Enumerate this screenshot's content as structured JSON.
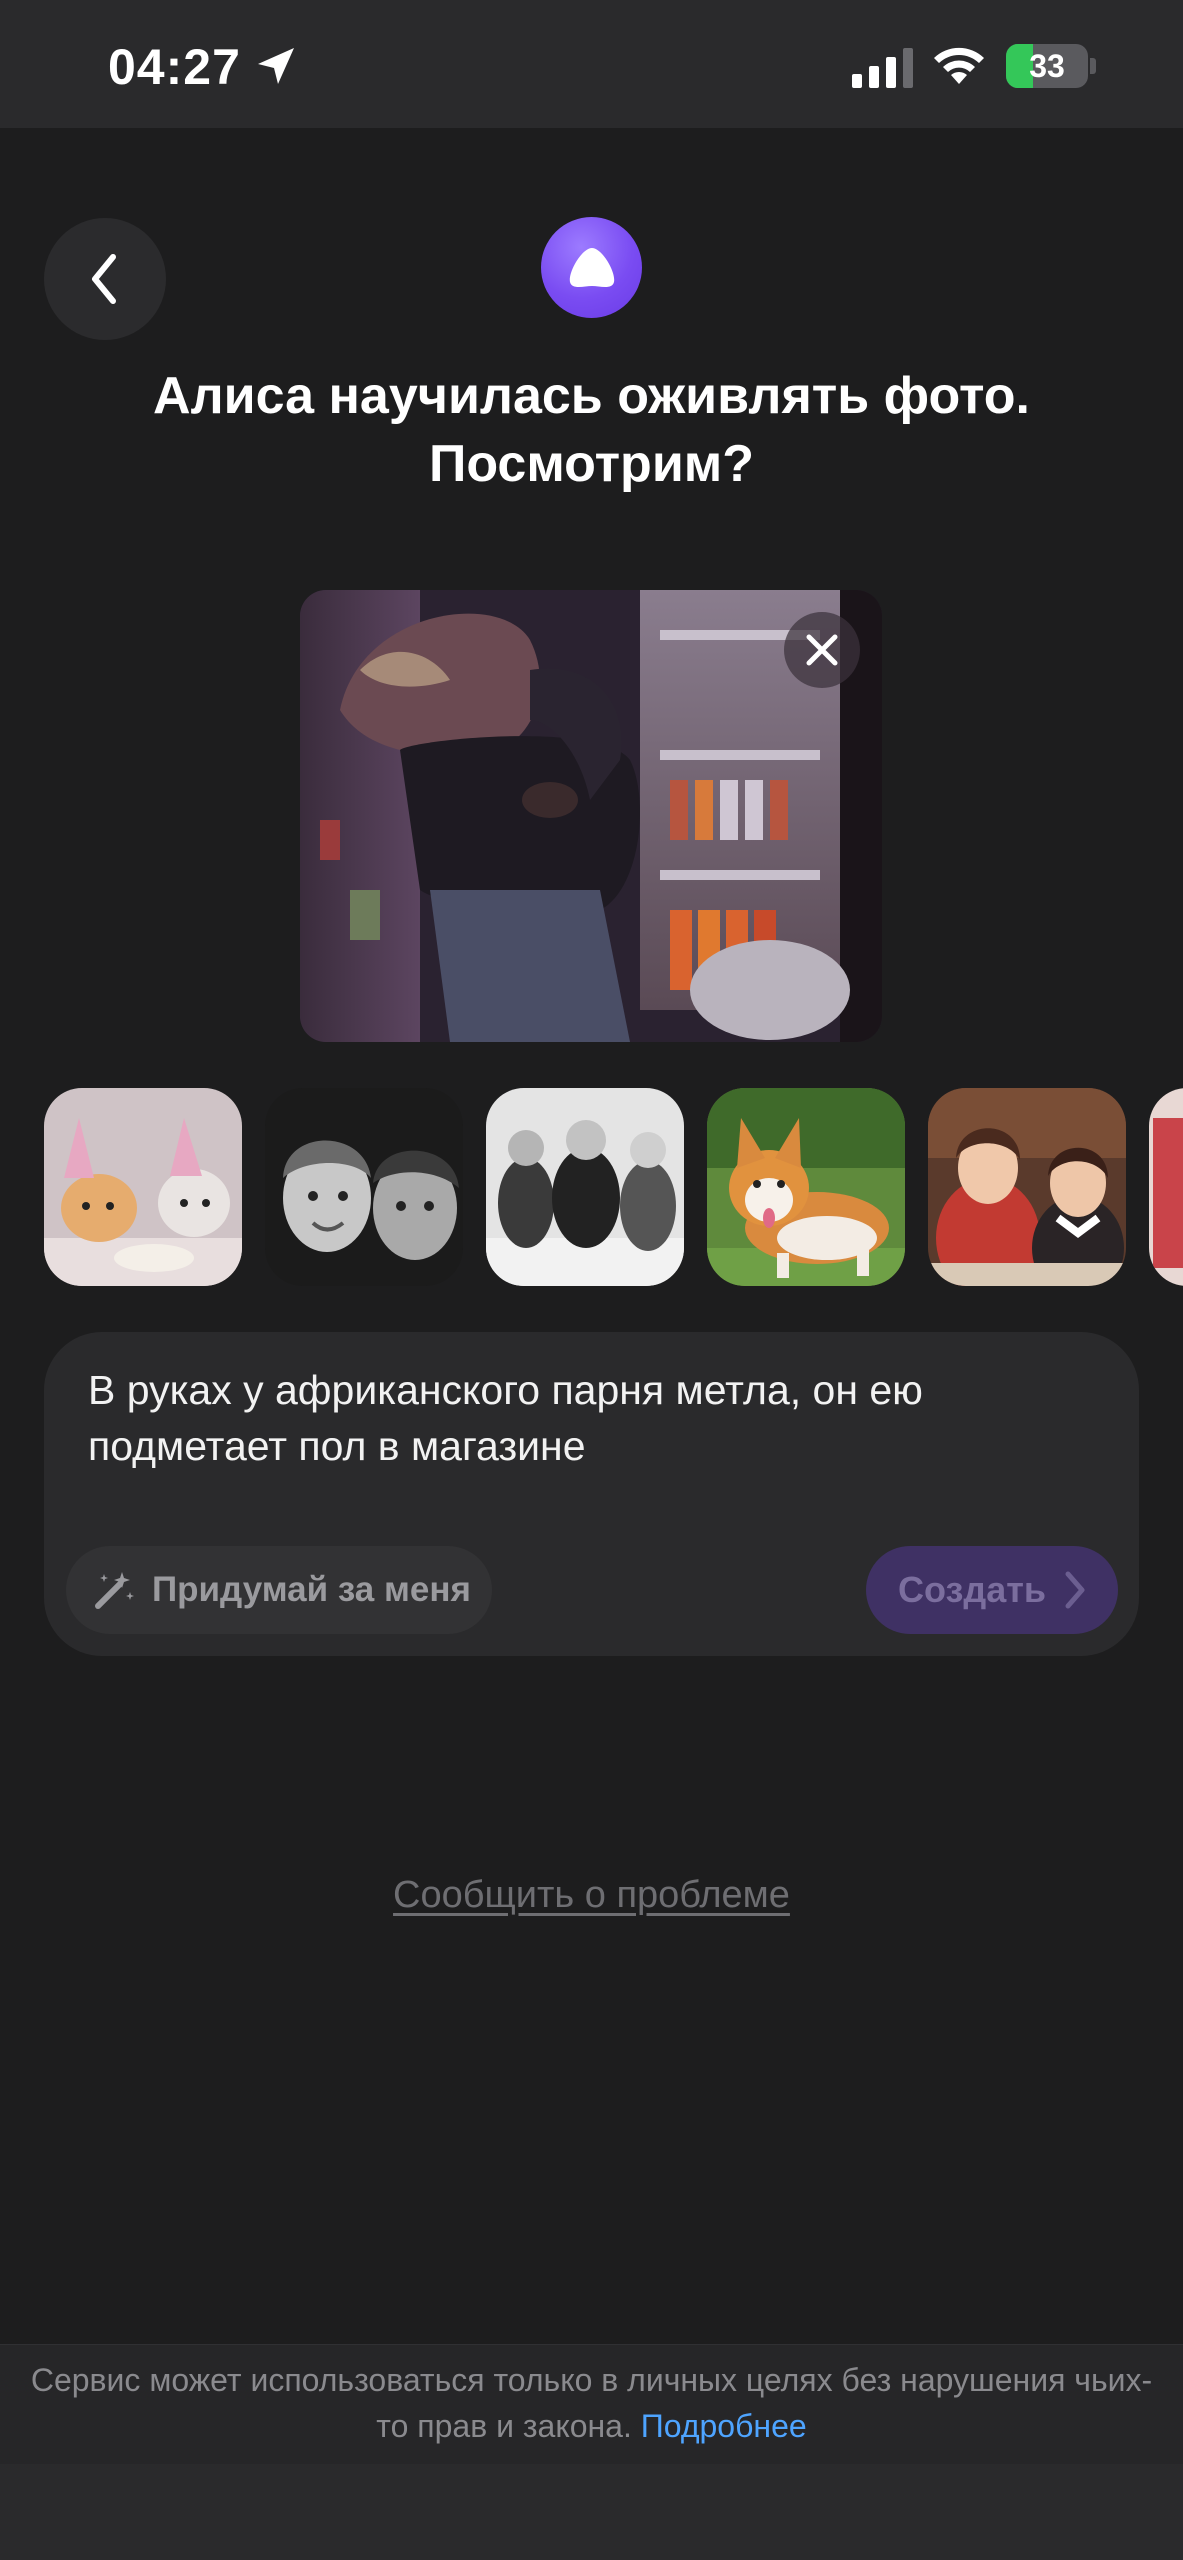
{
  "status_bar": {
    "time": "04:27",
    "battery_percent": 33,
    "battery_label": "33"
  },
  "header": {
    "title": "Алиса научилась оживлять фото. Посмотрим?"
  },
  "preview": {
    "close_icon": "close-icon"
  },
  "thumbnails": [
    {
      "subject": "kittens-in-party-hats"
    },
    {
      "subject": "two-children-black-and-white"
    },
    {
      "subject": "children-in-winter-coats"
    },
    {
      "subject": "corgi-dog"
    },
    {
      "subject": "girls-at-table"
    },
    {
      "subject": "partial-thumbnail"
    }
  ],
  "prompt": {
    "text": "В руках у африканского парня метла, он ею подметает пол в магазине",
    "suggest_label": "Придумай за меня",
    "create_label": "Создать"
  },
  "report_link": "Сообщить о проблеме",
  "footer": {
    "text": "Сервис может использоваться только в личных целях без нарушения чьих-то прав и закона.",
    "link": "Подробнее"
  },
  "colors": {
    "background": "#1d1d1e",
    "accent": "#7a4cf2",
    "link": "#4ea4ff",
    "create_button": "#3f3164"
  }
}
